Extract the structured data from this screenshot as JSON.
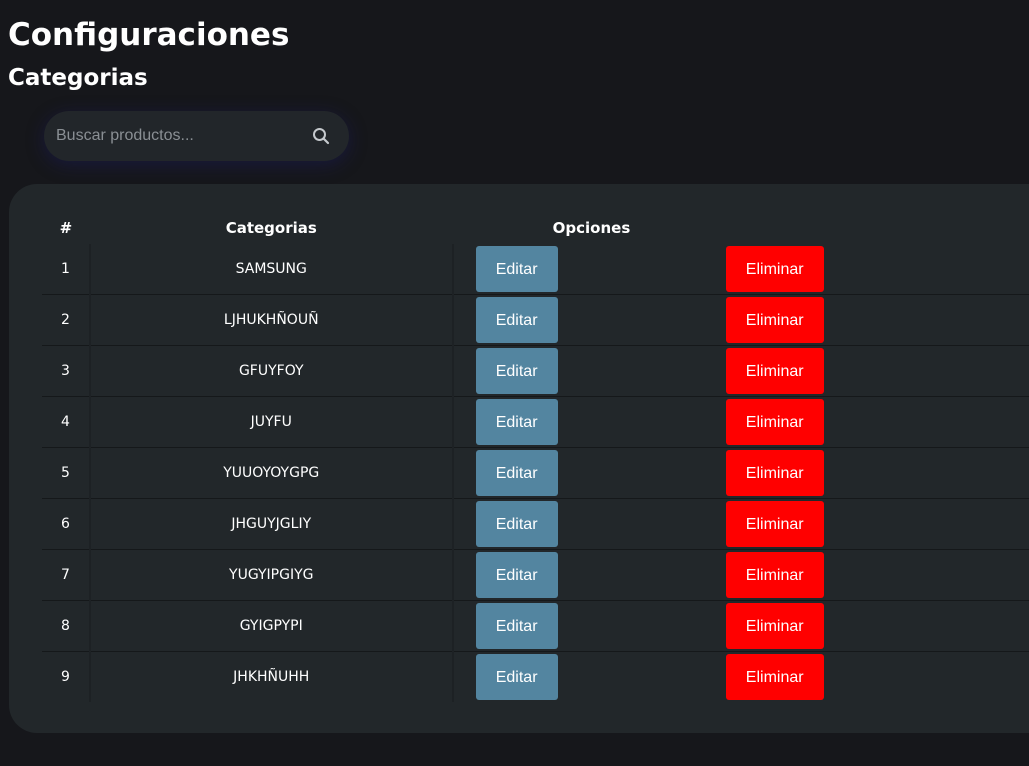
{
  "header": {
    "title": "Configuraciones",
    "subtitle": "Categorias"
  },
  "search": {
    "placeholder": "Buscar productos...",
    "value": "",
    "icon": "search-icon"
  },
  "table": {
    "columns": {
      "number": "#",
      "category": "Categorias",
      "options": "Opciones"
    },
    "edit_label": "Editar",
    "delete_label": "Eliminar",
    "rows": [
      {
        "num": "1",
        "name": "SAMSUNG"
      },
      {
        "num": "2",
        "name": "LJHUKHÑOUÑ"
      },
      {
        "num": "3",
        "name": "GFUYFOY"
      },
      {
        "num": "4",
        "name": "JUYFU"
      },
      {
        "num": "5",
        "name": "YUUOYOYGPG"
      },
      {
        "num": "6",
        "name": "JHGUYJGLIY"
      },
      {
        "num": "7",
        "name": "YUGYIPGIYG"
      },
      {
        "num": "8",
        "name": "GYIGPYPI"
      },
      {
        "num": "9",
        "name": "JHKHÑUHH"
      }
    ]
  },
  "colors": {
    "background": "#16171b",
    "panel": "#22272a",
    "edit_button": "#5385a0",
    "delete_button": "#ff0000"
  }
}
